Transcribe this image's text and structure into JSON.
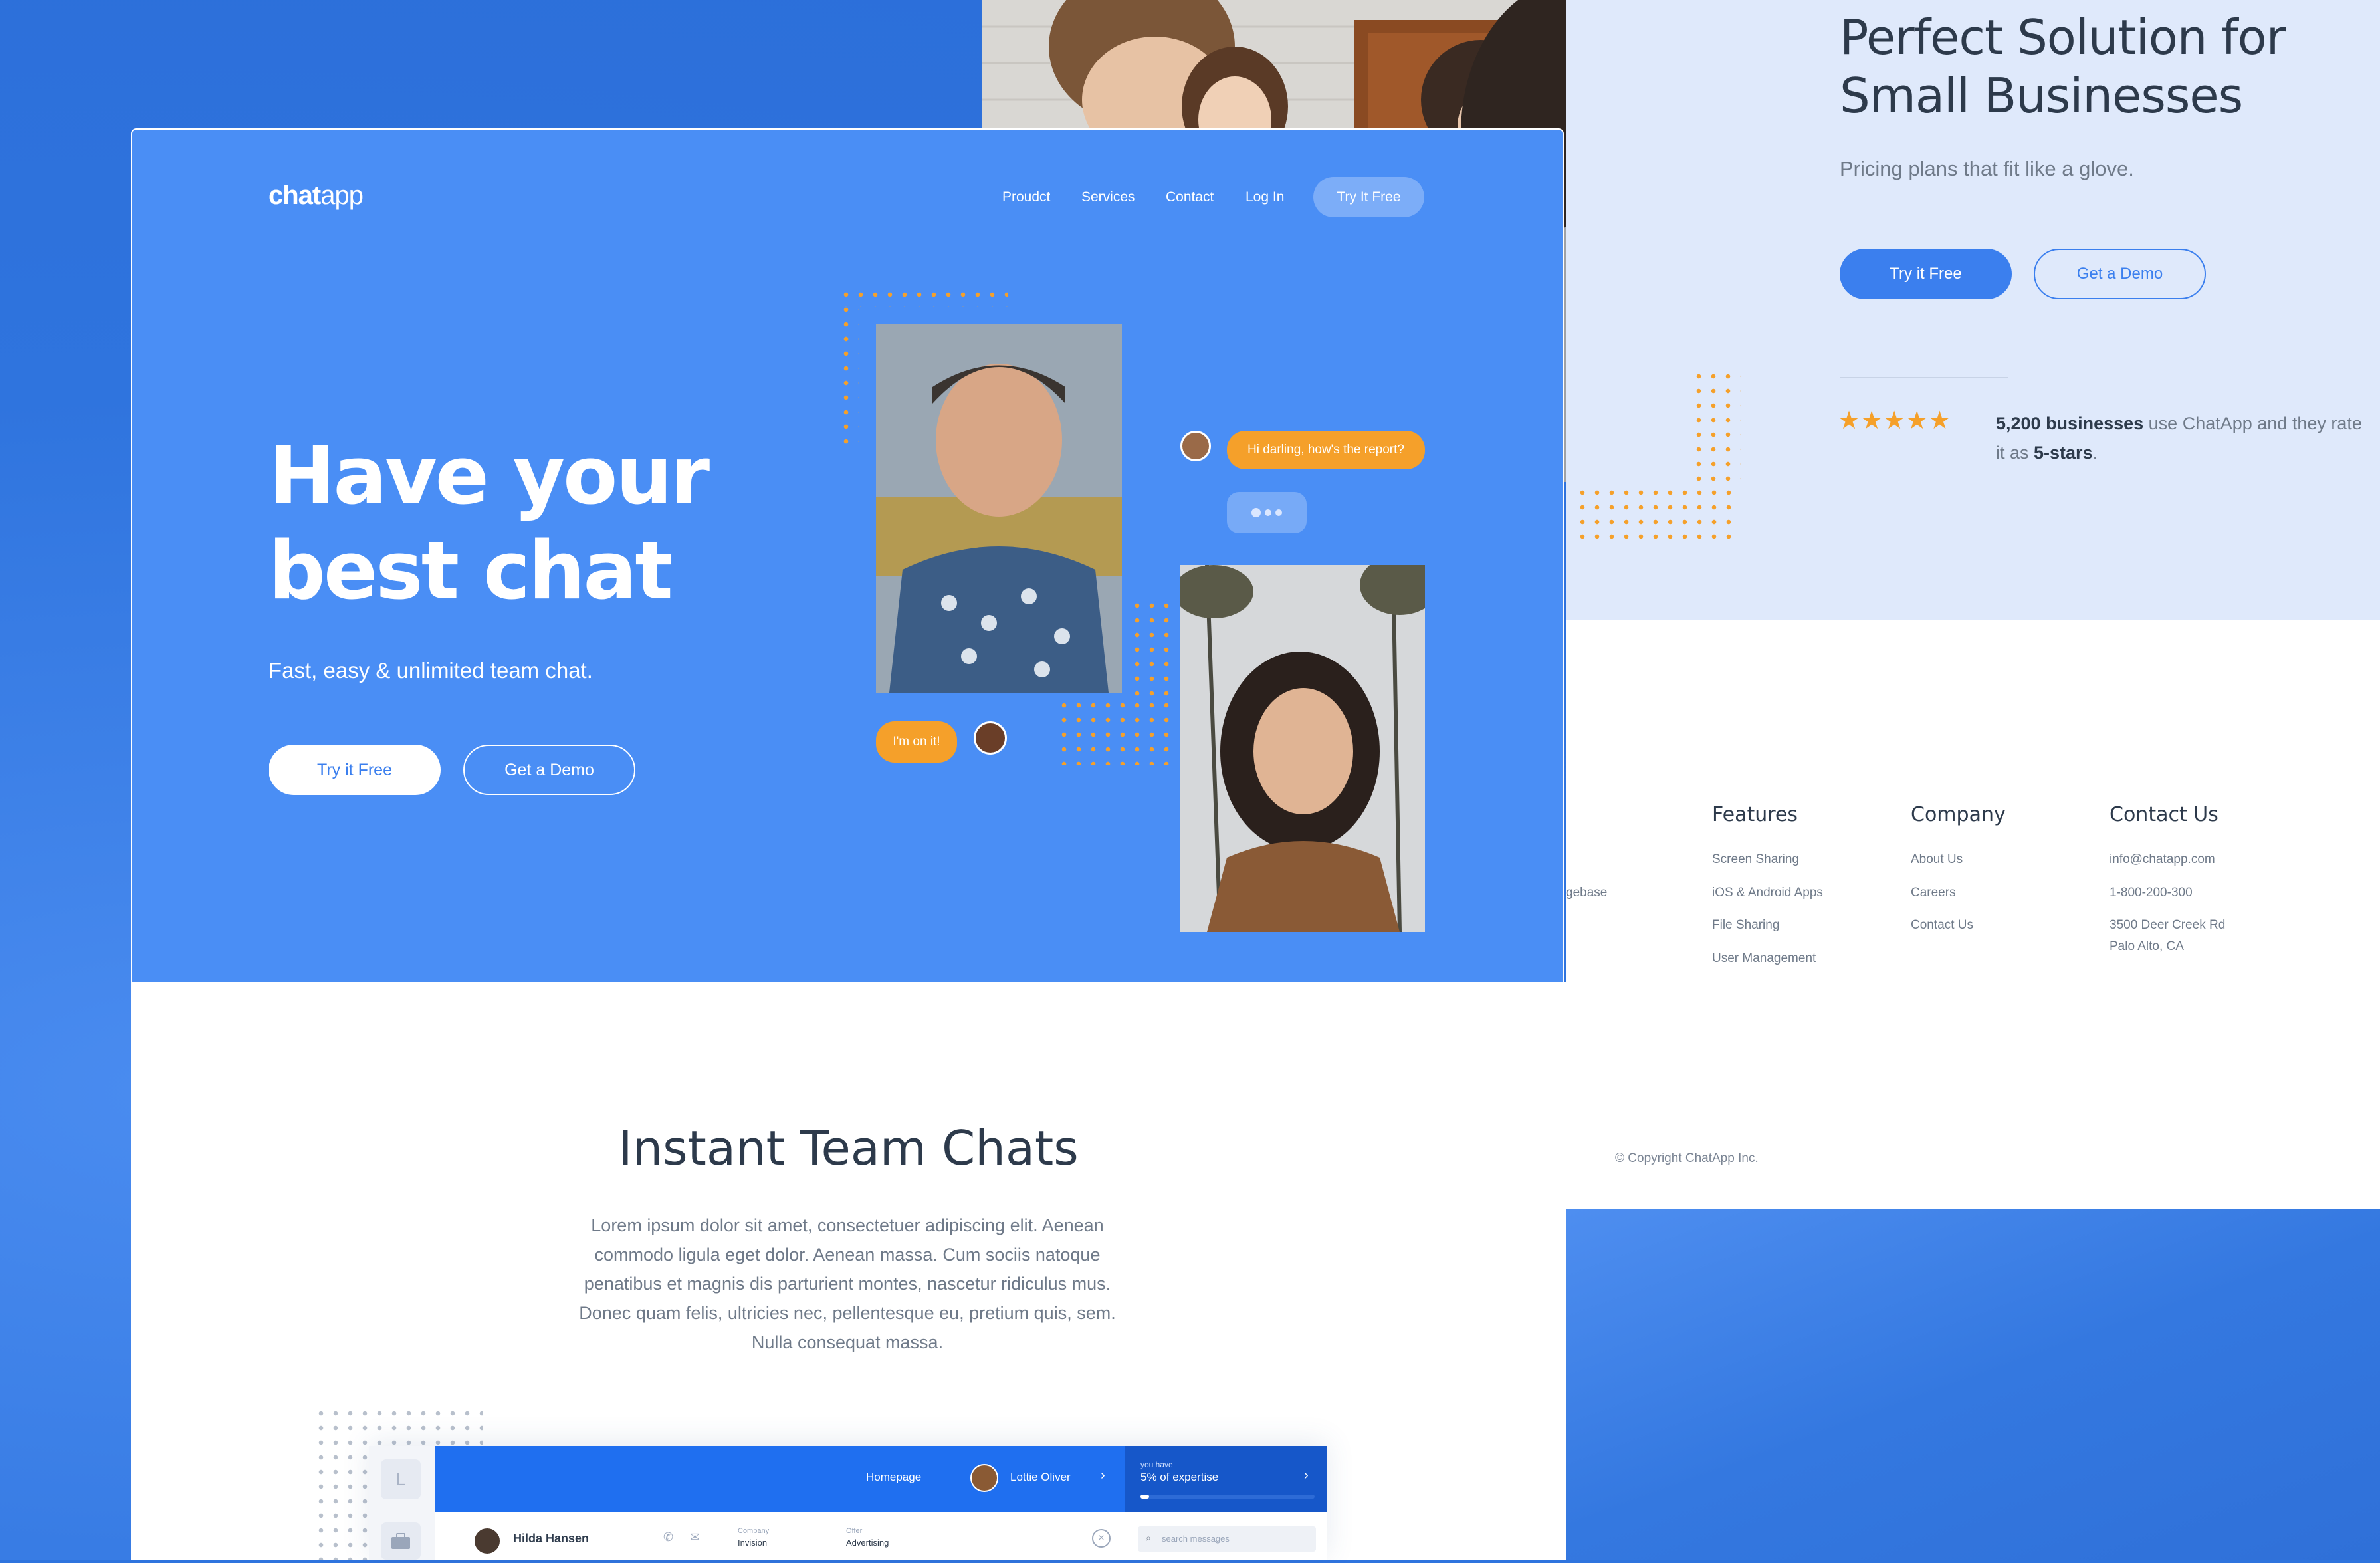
{
  "colors": {
    "brand_blue": "#4a8ef5",
    "accent_orange": "#f5a02a",
    "dark_text": "#2d3a4b",
    "muted_text": "#6f7a89"
  },
  "right_panel": {
    "title": "Perfect Solution for Small Businesses",
    "subtitle": "Pricing plans that fit like a glove.",
    "try_label": "Try it Free",
    "demo_label": "Get a Demo",
    "rating_count": "5,200 businesses",
    "rating_mid": " use ChatApp and they rate it as ",
    "rating_stars": "5-stars",
    "rating_end": ".",
    "stars": 5
  },
  "footer": {
    "partial_link": "gebase",
    "features": {
      "heading": "Features",
      "links": [
        "Screen Sharing",
        "iOS & Android Apps",
        "File Sharing",
        "User Management"
      ]
    },
    "company": {
      "heading": "Company",
      "links": [
        "About Us",
        "Careers",
        "Contact Us"
      ]
    },
    "contact": {
      "heading": "Contact Us",
      "links": [
        "info@chatapp.com",
        "1-800-200-300",
        "3500 Deer Creek Rd",
        "Palo Alto, CA"
      ]
    },
    "copyright": "© Copyright ChatApp Inc."
  },
  "hero": {
    "logo_bold": "chat",
    "logo_light": "app",
    "nav": [
      "Proudct",
      "Services",
      "Contact",
      "Log In"
    ],
    "nav_cta": "Try It Free",
    "title_line1": "Have your",
    "title_line2": "best chat",
    "subtitle": "Fast, easy & unlimited team chat.",
    "try_label": "Try it Free",
    "demo_label": "Get a Demo",
    "chat_message_1": "Hi darling, how's the report?",
    "chat_message_2": "I'm on it!"
  },
  "section": {
    "title": "Instant Team Chats",
    "body": "Lorem ipsum dolor sit amet, consectetuer adipiscing elit. Aenean commodo ligula eget dolor. Aenean massa. Cum sociis natoque penatibus et magnis dis parturient montes, nascetur ridiculus mus. Donec quam felis, ultricies nec, pellentesque eu, pretium quis, sem. Nulla consequat massa."
  },
  "app_preview": {
    "sidebar_letter": "L",
    "homepage": "Homepage",
    "user": "Lottie Oliver",
    "you_have": "you have",
    "expertise": "5% of expertise",
    "contact_name": "Hilda Hansen",
    "company_label": "Company",
    "company_value": "Invision",
    "offer_label": "Offer",
    "offer_value": "Advertising",
    "search_placeholder": "search messages"
  }
}
